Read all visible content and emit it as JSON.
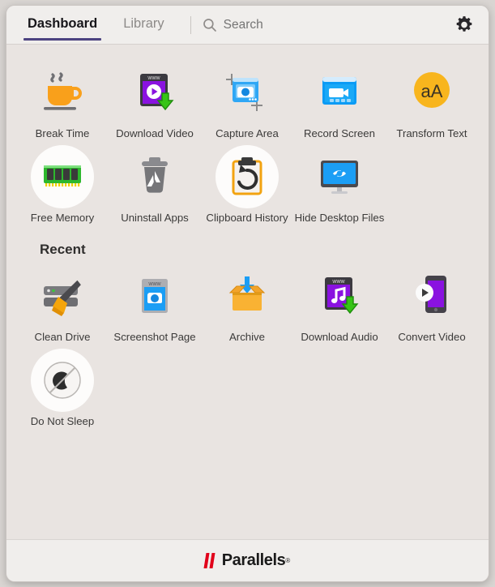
{
  "header": {
    "tabs": [
      {
        "label": "Dashboard",
        "active": true
      },
      {
        "label": "Library",
        "active": false
      }
    ],
    "search": {
      "placeholder": "Search",
      "value": "",
      "icon": "search-icon"
    },
    "settings_icon": "gear-icon",
    "active_tab_underline_color": "#4c4380"
  },
  "main": {
    "tools": [
      {
        "label": "Break Time",
        "icon": "coffee-cup-icon",
        "highlighted": false
      },
      {
        "label": "Download Video",
        "icon": "download-video-icon",
        "highlighted": false
      },
      {
        "label": "Capture Area",
        "icon": "capture-area-icon",
        "highlighted": false
      },
      {
        "label": "Record Screen",
        "icon": "record-screen-icon",
        "highlighted": false
      },
      {
        "label": "Transform Text",
        "icon": "transform-text-icon",
        "highlighted": false
      },
      {
        "label": "Free Memory",
        "icon": "memory-stick-icon",
        "highlighted": true
      },
      {
        "label": "Uninstall Apps",
        "icon": "uninstall-apps-icon",
        "highlighted": false
      },
      {
        "label": "Clipboard History",
        "icon": "clipboard-history-icon",
        "highlighted": true
      },
      {
        "label": "Hide Desktop Files",
        "icon": "hide-desktop-icon",
        "highlighted": false
      }
    ],
    "recent_title": "Recent",
    "recent": [
      {
        "label": "Clean Drive",
        "icon": "clean-drive-icon",
        "highlighted": false
      },
      {
        "label": "Screenshot Page",
        "icon": "screenshot-page-icon",
        "highlighted": false
      },
      {
        "label": "Archive",
        "icon": "archive-box-icon",
        "highlighted": false
      },
      {
        "label": "Download Audio",
        "icon": "download-audio-icon",
        "highlighted": false
      },
      {
        "label": "Convert Video",
        "icon": "convert-video-icon",
        "highlighted": false
      },
      {
        "label": "Do Not Sleep",
        "icon": "do-not-sleep-icon",
        "highlighted": true
      }
    ]
  },
  "footer": {
    "brand": "Parallels",
    "registered_mark": "®",
    "logo_bar_color": "#e1001a"
  },
  "colors": {
    "window_background": "#e9e4e1",
    "header_background": "#f0eeec",
    "footer_background": "#f0eeec",
    "label_text": "#3b3a39"
  }
}
